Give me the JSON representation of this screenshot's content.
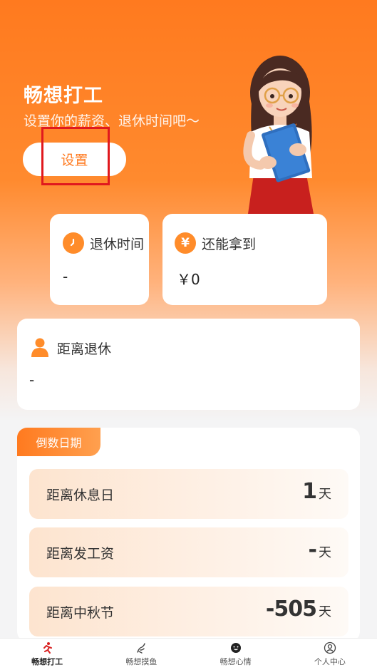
{
  "hero": {
    "title": "畅想打工",
    "subtitle": "设置你的薪资、退休时间吧～",
    "setup_button": "设置"
  },
  "stats": {
    "retire_time": {
      "label": "退休时间",
      "value": "-",
      "icon": "clock-icon"
    },
    "can_earn": {
      "label": "还能拿到",
      "value": "￥0",
      "icon": "yen-icon"
    }
  },
  "distance_retire": {
    "label": "距离退休",
    "value": "-",
    "icon": "person-icon"
  },
  "countdown": {
    "tab_label": "倒数日期",
    "rows": [
      {
        "label": "距离休息日",
        "value": "1",
        "unit": "天"
      },
      {
        "label": "距离发工资",
        "value": "-",
        "unit": "天"
      },
      {
        "label": "距离中秋节",
        "value": "-505",
        "unit": "天"
      }
    ]
  },
  "tabbar": {
    "items": [
      {
        "label": "畅想打工",
        "icon": "running-icon",
        "active": true
      },
      {
        "label": "畅想摸鱼",
        "icon": "fish-hand-icon",
        "active": false
      },
      {
        "label": "畅想心情",
        "icon": "smile-face-icon",
        "active": false
      },
      {
        "label": "个人中心",
        "icon": "user-icon",
        "active": false
      }
    ]
  },
  "colors": {
    "accent": "#ff7a1f",
    "highlight_box": "#e0191e"
  }
}
